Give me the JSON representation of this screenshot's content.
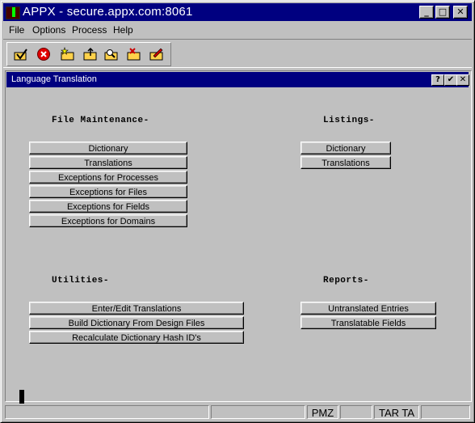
{
  "window": {
    "title": "APPX - secure.appx.com:8061",
    "controls": {
      "minimize": "_",
      "maximize": "□",
      "close": "✕"
    }
  },
  "menubar": {
    "items": [
      {
        "label": "File"
      },
      {
        "label": "Options"
      },
      {
        "label": "Process"
      },
      {
        "label": "Help"
      }
    ]
  },
  "toolbar": {
    "tools": [
      {
        "icon": "check-folder-icon"
      },
      {
        "icon": "cancel-icon"
      },
      {
        "icon": "star-folder-icon"
      },
      {
        "icon": "up-folder-icon"
      },
      {
        "icon": "search-folder-icon"
      },
      {
        "icon": "delete-folder-icon"
      },
      {
        "icon": "edit-folder-icon"
      }
    ]
  },
  "dialog": {
    "title": "Language Translation",
    "controls": {
      "help": "?",
      "ok": "✔",
      "close": "✕"
    },
    "sections": {
      "file_maintenance": {
        "heading": "File Maintenance-",
        "buttons": [
          "Dictionary",
          "Translations",
          "Exceptions for Processes",
          "Exceptions for Files",
          "Exceptions for Fields",
          "Exceptions for Domains"
        ]
      },
      "listings": {
        "heading": "Listings-",
        "buttons": [
          "Dictionary",
          "Translations"
        ]
      },
      "utilities": {
        "heading": "Utilities-",
        "buttons": [
          "Enter/Edit Translations",
          "Build Dictionary From Design Files",
          "Recalculate Dictionary Hash ID's"
        ]
      },
      "reports": {
        "heading": "Reports-",
        "buttons": [
          "Untranslated Entries",
          "Translatable Fields"
        ]
      }
    }
  },
  "statusbar": {
    "panels": [
      "",
      "",
      "PMZ",
      "",
      "TAR TA",
      ""
    ]
  }
}
